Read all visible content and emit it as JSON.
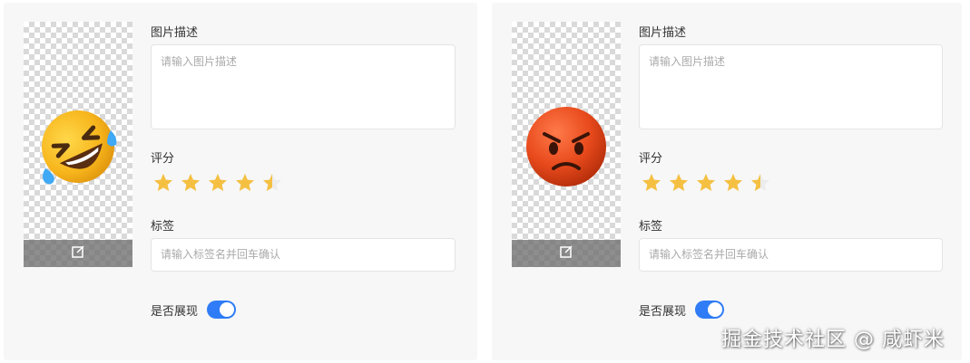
{
  "cards": [
    {
      "emoji": "rolling-on-floor-laughing",
      "description_label": "图片描述",
      "description_placeholder": "请输入图片描述",
      "rating_label": "评分",
      "rating": 4.5,
      "tags_label": "标签",
      "tags_placeholder": "请输入标签名并回车确认",
      "show_label": "是否展现",
      "show_enabled": true,
      "edit_icon": "edit-icon"
    },
    {
      "emoji": "angry-face",
      "description_label": "图片描述",
      "description_placeholder": "请输入图片描述",
      "rating_label": "评分",
      "rating": 4.5,
      "tags_label": "标签",
      "tags_placeholder": "请输入标签名并回车确认",
      "show_label": "是否展现",
      "show_enabled": true,
      "edit_icon": "edit-icon"
    }
  ],
  "watermark": "掘金技术社区 @ 咸虾米",
  "colors": {
    "star": "#f5c042",
    "toggle": "#2f7cf6",
    "card_bg": "#f7f7f7"
  }
}
